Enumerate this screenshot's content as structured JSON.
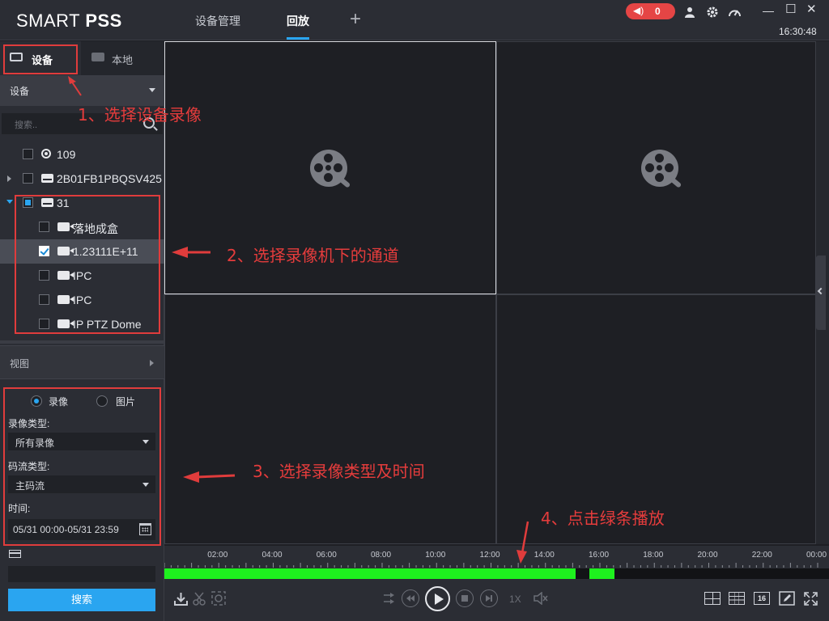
{
  "app": {
    "logo_light": "SMART ",
    "logo_bold": "PSS",
    "tabs": [
      {
        "label": "设备管理"
      },
      {
        "label": "回放"
      }
    ],
    "add_tab_glyph": "+",
    "alarm_count": "0",
    "clock": "16:30:48",
    "window_controls": {
      "minimize": "—",
      "maximize": "☐",
      "close": "✕"
    }
  },
  "left_panel": {
    "tabs": {
      "device": "设备",
      "local": "本地"
    },
    "device_select": "设备",
    "search_placeholder": "搜索..",
    "tree": [
      {
        "label": "109",
        "icon": "webcam-icon",
        "level": 0,
        "checked": "none"
      },
      {
        "label": "2B01FB1PBQSV425",
        "icon": "nvr-icon",
        "level": 0,
        "checked": "none",
        "expand": "collapsed"
      },
      {
        "label": "31",
        "icon": "nvr-icon",
        "level": 0,
        "checked": "partial",
        "expand": "expanded"
      },
      {
        "label": "落地成盒",
        "icon": "camera-icon",
        "level": 1,
        "checked": "none"
      },
      {
        "label": "1.23111E+11",
        "icon": "camera-icon",
        "level": 1,
        "checked": "checked",
        "selected": true
      },
      {
        "label": "IPC",
        "icon": "camera-icon",
        "level": 1,
        "checked": "none"
      },
      {
        "label": "IPC",
        "icon": "camera-icon",
        "level": 1,
        "checked": "none"
      },
      {
        "label": "IP PTZ Dome",
        "icon": "camera-icon",
        "level": 1,
        "checked": "none"
      }
    ],
    "view_label": "视图",
    "filter": {
      "radio_record": "录像",
      "radio_picture": "图片",
      "record_type_label": "录像类型:",
      "record_type_value": "所有录像",
      "stream_type_label": "码流类型:",
      "stream_type_value": "主码流",
      "time_label": "时间:",
      "time_value": "05/31 00:00-05/31 23:59"
    },
    "search_button": "搜索"
  },
  "timeline": {
    "labels": [
      "02:00",
      "04:00",
      "06:00",
      "08:00",
      "10:00",
      "12:00",
      "14:00",
      "16:00",
      "18:00",
      "20:00",
      "22:00",
      "00:00"
    ],
    "speed": "1X",
    "layout_16": "16",
    "recordings": [
      {
        "start_hour": 0.0,
        "end_hour": 15.1
      },
      {
        "start_hour": 15.62,
        "end_hour": 16.55
      }
    ]
  },
  "annotations": {
    "step1": "1、选择设备录像",
    "step2": "2、选择录像机下的通道",
    "step3": "3、选择录像类型及时间",
    "step4": "4、点击绿条播放",
    "color": "#e03c3c"
  },
  "colors": {
    "accent": "#2aa5f0",
    "record_bar": "#1ef11e",
    "alarm": "#e54545"
  }
}
